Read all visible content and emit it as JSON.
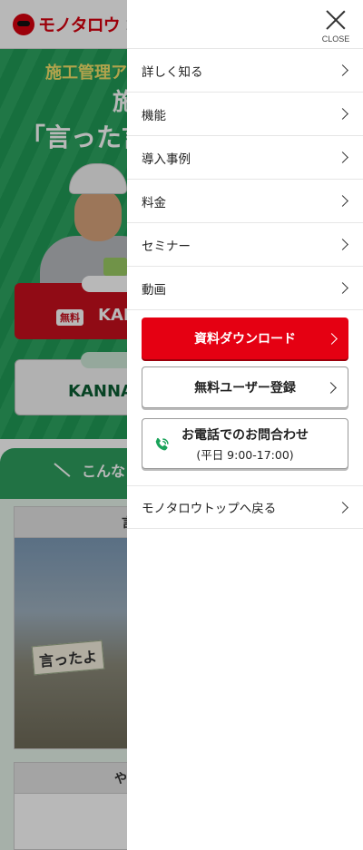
{
  "background": {
    "logo_text": "モノタロウ",
    "logo_x": "×",
    "hero": {
      "kicker": "施工管理ア",
      "line1": "施",
      "line2": "「言った言"
    },
    "cta_red": {
      "badge": "無料",
      "label": "KAN"
    },
    "cta_white": {
      "label": "KANNA"
    },
    "section_tag": "こんな",
    "card1": {
      "head": "言",
      "sign": "言ったよ"
    },
    "card2": {
      "head": "や"
    }
  },
  "drawer": {
    "close_label": "CLOSE",
    "menu": [
      {
        "label": "詳しく知る"
      },
      {
        "label": "機能"
      },
      {
        "label": "導入事例"
      },
      {
        "label": "料金"
      },
      {
        "label": "セミナー"
      },
      {
        "label": "動画"
      }
    ],
    "download_button": "資料ダウンロード",
    "register_button": "無料ユーザー登録",
    "phone": {
      "title": "お電話でのお問合わせ",
      "hours": "(平日 9:00-17:00)"
    },
    "back_link": "モノタロウトップへ戻る"
  },
  "colors": {
    "accent_red": "#e50012",
    "hero_green": "#22a05a",
    "phone_icon_green": "#1aa35a"
  }
}
